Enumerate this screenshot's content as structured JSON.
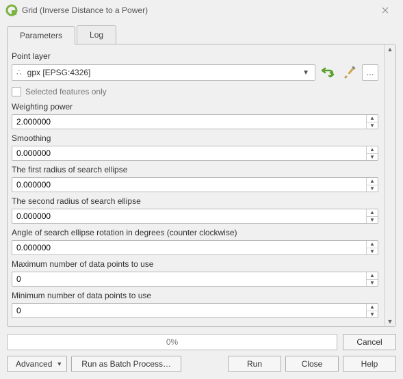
{
  "window": {
    "title": "Grid (Inverse Distance to a Power)"
  },
  "tabs": {
    "parameters": "Parameters",
    "log": "Log",
    "active": "parameters"
  },
  "point_layer": {
    "label": "Point layer",
    "value": "gpx [EPSG:4326]"
  },
  "selected_only": {
    "label": "Selected features only",
    "checked": false
  },
  "fields": [
    {
      "label": "Weighting power",
      "value": "2.000000"
    },
    {
      "label": "Smoothing",
      "value": "0.000000"
    },
    {
      "label": "The first radius of search ellipse",
      "value": "0.000000"
    },
    {
      "label": "The second radius of search ellipse",
      "value": "0.000000"
    },
    {
      "label": "Angle of search ellipse rotation in degrees (counter clockwise)",
      "value": "0.000000"
    },
    {
      "label": "Maximum number of data points to use",
      "value": "0"
    },
    {
      "label": "Minimum number of data points to use",
      "value": "0"
    }
  ],
  "progress": {
    "text": "0%"
  },
  "buttons": {
    "cancel": "Cancel",
    "advanced": "Advanced",
    "batch": "Run as Batch Process…",
    "run": "Run",
    "close": "Close",
    "help": "Help"
  }
}
